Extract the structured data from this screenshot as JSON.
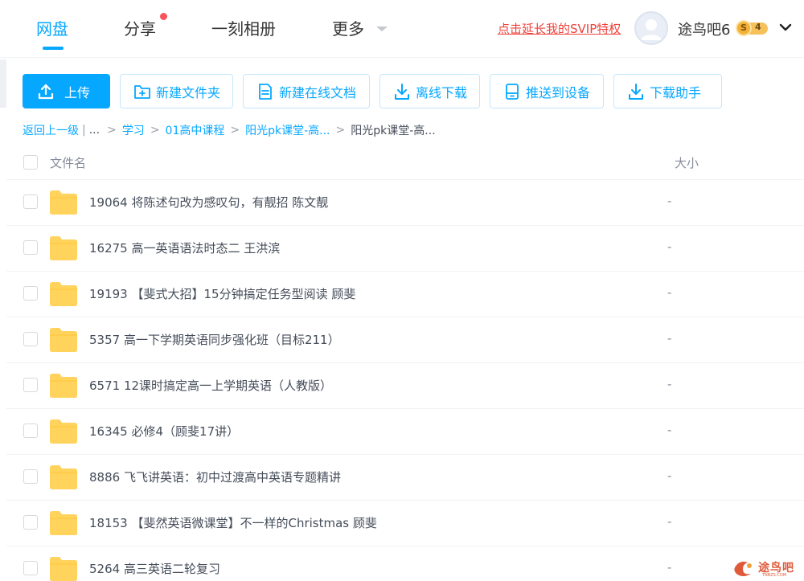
{
  "nav": {
    "tabs": [
      {
        "label": "网盘",
        "active": true
      },
      {
        "label": "分享",
        "active": false,
        "has_notification_dot": true
      },
      {
        "label": "一刻相册",
        "active": false
      },
      {
        "label": "更多",
        "active": false,
        "has_dropdown": true
      }
    ],
    "svip_promo": "点击延长我的SVIP特权",
    "username": "途鸟吧6",
    "vip_badge_letter": "S",
    "vip_level": "4",
    "avatar_icon": "default-avatar-icon",
    "user_menu_icon": "chevron-down-icon"
  },
  "toolbar": {
    "upload": {
      "label": "上传",
      "icon": "upload-icon"
    },
    "new_folder": {
      "label": "新建文件夹",
      "icon": "folder-plus-icon"
    },
    "new_online_doc": {
      "label": "新建在线文档",
      "icon": "document-icon"
    },
    "offline_download": {
      "label": "离线下载",
      "icon": "download-icon"
    },
    "push_to_device": {
      "label": "推送到设备",
      "icon": "device-icon"
    },
    "download_helper": {
      "label": "下载助手",
      "icon": "download-icon"
    }
  },
  "breadcrumb": {
    "back": "返回上一级",
    "divider": "|",
    "ellipsis": "...",
    "items": [
      "学习",
      "01高中课程",
      "阳光pk课堂-高..."
    ],
    "current": "阳光pk课堂-高...",
    "separator": ">"
  },
  "table": {
    "columns": {
      "name": "文件名",
      "size": "大小"
    },
    "rows": [
      {
        "name": "19064 将陈述句改为感叹句，有靓招 陈文靓",
        "size": "-",
        "type": "folder"
      },
      {
        "name": "16275 高一英语语法时态二 王洪滨",
        "size": "-",
        "type": "folder"
      },
      {
        "name": "19193 【斐式大招】15分钟搞定任务型阅读 顾斐",
        "size": "-",
        "type": "folder"
      },
      {
        "name": "5357 高一下学期英语同步强化班（目标211）",
        "size": "-",
        "type": "folder"
      },
      {
        "name": "6571 12课时搞定高一上学期英语（人教版）",
        "size": "-",
        "type": "folder"
      },
      {
        "name": "16345 必修4（顾斐17讲）",
        "size": "-",
        "type": "folder"
      },
      {
        "name": "8886 飞飞讲英语：初中过渡高中英语专题精讲",
        "size": "-",
        "type": "folder"
      },
      {
        "name": "18153 【斐然英语微课堂】不一样的Christmas 顾斐",
        "size": "-",
        "type": "folder"
      },
      {
        "name": "5264 高三英语二轮复习",
        "size": "-",
        "type": "folder"
      }
    ]
  },
  "watermark": {
    "text": "途鸟吧",
    "sub": "TNBZS.COM"
  },
  "colors": {
    "accent": "#06a7ff",
    "promo": "#f0423b",
    "folder": "#ffd35c",
    "badge": "#f6c05a"
  }
}
